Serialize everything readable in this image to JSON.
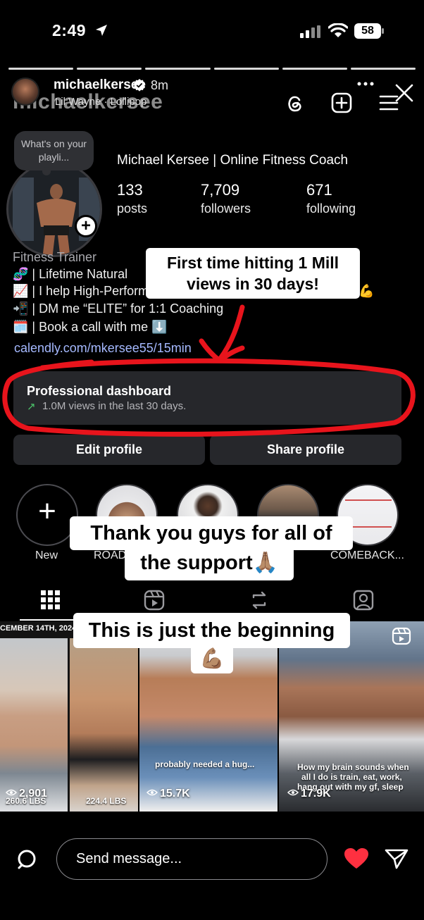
{
  "status_bar": {
    "time": "2:49",
    "battery": "58"
  },
  "story": {
    "username": "michaelkersee",
    "time_ago": "8m",
    "music": "Lil Wayne · Lollipop",
    "ghost_username": "michaelkersee",
    "progress_segments": 6
  },
  "profile": {
    "note": "What's on your playli...",
    "display_name": "Michael Kersee | Online Fitness Coach",
    "stats": {
      "posts": {
        "value": "133",
        "label": "posts"
      },
      "followers": {
        "value": "7,709",
        "label": "followers"
      },
      "following": {
        "value": "671",
        "label": "following"
      }
    },
    "category": "Fitness Trainer",
    "bio": [
      "🧬 | Lifetime Natural",
      "📈 | I help High-Performe",
      "📲 | DM me “ELITE” for 1:1 Coaching",
      "🗓️ | Book a call with me ⬇️"
    ],
    "bio_tail": "sique💪",
    "link": "calendly.com/mkersee55/15min"
  },
  "dashboard": {
    "title": "Professional dashboard",
    "subtitle": "1.0M views in the last 30 days."
  },
  "buttons": {
    "edit": "Edit profile",
    "share": "Share profile"
  },
  "highlights": [
    {
      "label": "New"
    },
    {
      "label": "ROAD"
    },
    {
      "label": ""
    },
    {
      "label": ""
    },
    {
      "label": "COMEBACK..."
    }
  ],
  "grid": {
    "tile1": {
      "date": "CEMBER 14TH, 2024",
      "views": "2,901",
      "left_weight": "260.6 LBS",
      "right_weight": "224.4 LBS"
    },
    "tile2": {
      "caption": "probably needed a hug...",
      "views": "15.7K"
    },
    "tile3": {
      "caption_1": "How my brain sounds when",
      "caption_2": "all I do is train, eat, work,",
      "caption_3": "hang out with my gf, sleep",
      "views": "17.9K"
    }
  },
  "overlays": {
    "sticker_1": "First time hitting 1 Mill views in 30 days!",
    "sticker_2a": "Thank you guys for all of",
    "sticker_2b": "the support🙏🏽",
    "sticker_3": "This is just the beginning",
    "sticker_3b": "💪🏽"
  },
  "bottom_bar": {
    "message_placeholder": "Send message..."
  },
  "colors": {
    "background": "#000000",
    "card": "#26272b",
    "link": "#a5b9ff",
    "annotation_red": "#e8141c",
    "heart": "#ff3040",
    "trend_green": "#4cc36a"
  }
}
